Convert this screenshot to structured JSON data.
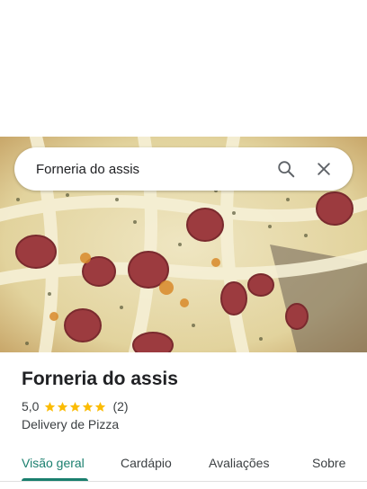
{
  "search": {
    "query": "Forneria do assis"
  },
  "place": {
    "name": "Forneria do assis",
    "rating": "5,0",
    "stars": 5,
    "review_count": "(2)",
    "category": "Delivery de Pizza"
  },
  "tabs": [
    {
      "label": "Visão geral",
      "active": true
    },
    {
      "label": "Cardápio",
      "active": false
    },
    {
      "label": "Avaliações",
      "active": false
    },
    {
      "label": "Sobre",
      "active": false
    }
  ],
  "colors": {
    "accent": "#1a7f6e",
    "star": "#fbbc04"
  }
}
